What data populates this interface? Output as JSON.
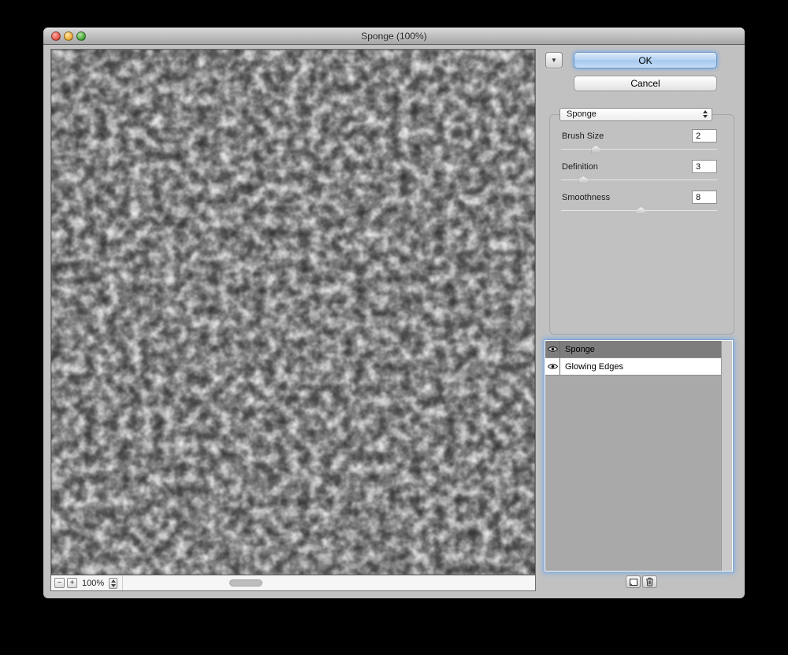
{
  "window": {
    "title": "Sponge (100%)"
  },
  "buttons": {
    "ok": "OK",
    "cancel": "Cancel"
  },
  "filter_popup": {
    "selected": "Sponge"
  },
  "sliders": [
    {
      "label": "Brush Size",
      "value": "2",
      "pos": 22
    },
    {
      "label": "Definition",
      "value": "3",
      "pos": 14
    },
    {
      "label": "Smoothness",
      "value": "8",
      "pos": 51
    }
  ],
  "zoom": {
    "zoom_out": "−",
    "zoom_in": "+",
    "level": "100%"
  },
  "effect_layers": [
    {
      "name": "Sponge",
      "selected": true
    },
    {
      "name": "Glowing Edges",
      "selected": false
    }
  ],
  "icons": {
    "disclosure": "▼"
  },
  "colors": {
    "ok_button_fill": "#b6d3f2",
    "focus_ring": "#78acE8",
    "selected_row": "#7d7d7d",
    "window_chrome": "#c1c1c1"
  }
}
